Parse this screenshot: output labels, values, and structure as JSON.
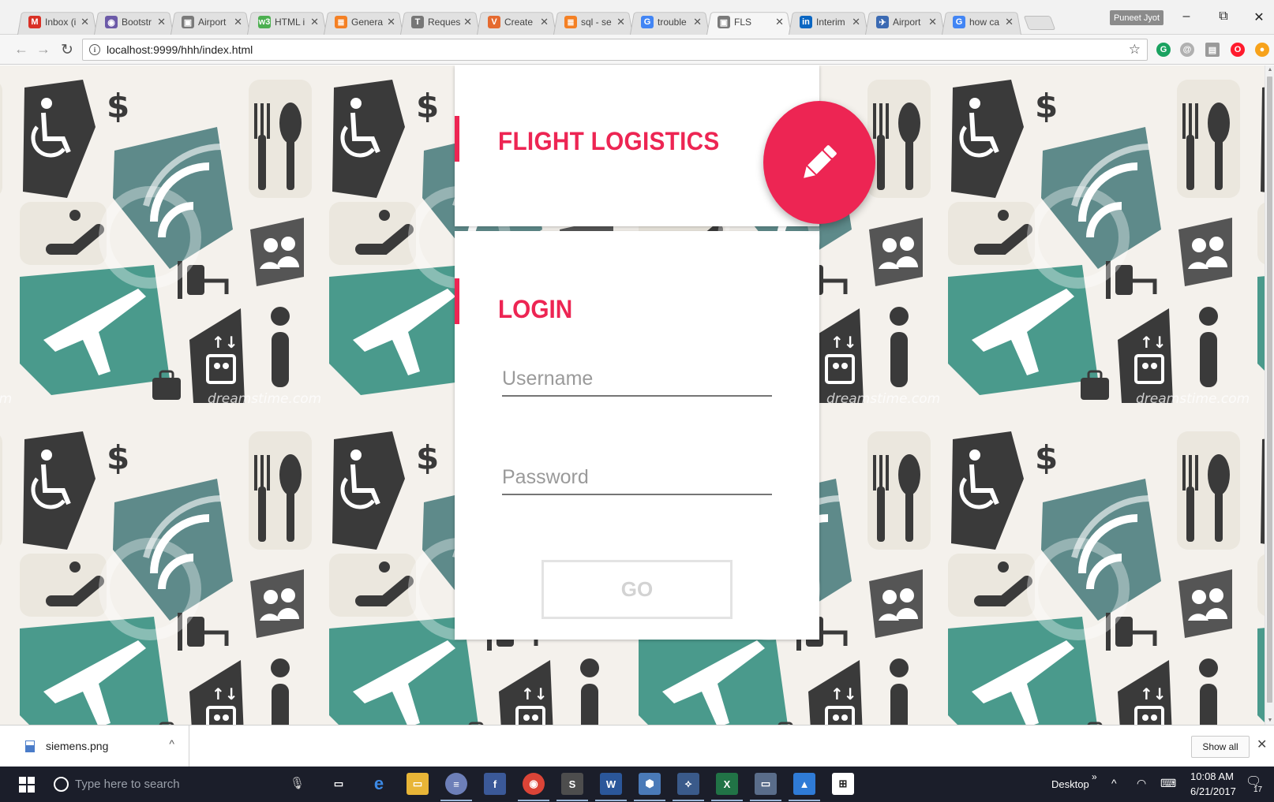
{
  "browser": {
    "tabs": [
      {
        "title": "Inbox (i",
        "favicon": "gmail-icon",
        "favicon_text": "M",
        "favicon_color": "#d93025",
        "active": false
      },
      {
        "title": "Bootstr",
        "favicon": "bootstrap-icon",
        "favicon_text": "◉",
        "favicon_color": "#6c5aa8",
        "active": false
      },
      {
        "title": "Airport",
        "favicon": "image-icon",
        "favicon_text": "▣",
        "favicon_color": "#7a7a7a",
        "active": false
      },
      {
        "title": "HTML i",
        "favicon": "w3schools-icon",
        "favicon_text": "w3",
        "favicon_color": "#4caf50",
        "active": false
      },
      {
        "title": "Genera",
        "favicon": "stackoverflow-icon",
        "favicon_text": "≣",
        "favicon_color": "#f48024",
        "active": false
      },
      {
        "title": "Reques",
        "favicon": "text-icon",
        "favicon_text": "T",
        "favicon_color": "#777777",
        "active": false
      },
      {
        "title": "Create",
        "favicon": "mailchimp-icon",
        "favicon_text": "V",
        "favicon_color": "#e56a2f",
        "active": false
      },
      {
        "title": "sql - se",
        "favicon": "stackoverflow-icon",
        "favicon_text": "≣",
        "favicon_color": "#f48024",
        "active": false
      },
      {
        "title": "trouble",
        "favicon": "google-icon",
        "favicon_text": "G",
        "favicon_color": "#4285f4",
        "active": false
      },
      {
        "title": "FLS",
        "favicon": "image-icon",
        "favicon_text": "▣",
        "favicon_color": "#7a7a7a",
        "active": true
      },
      {
        "title": "Interim",
        "favicon": "linkedin-icon",
        "favicon_text": "in",
        "favicon_color": "#0a66c2",
        "active": false
      },
      {
        "title": "Airport",
        "favicon": "airplane-icon",
        "favicon_text": "✈",
        "favicon_color": "#3b6ab3",
        "active": false
      },
      {
        "title": "how ca",
        "favicon": "google-icon",
        "favicon_text": "G",
        "favicon_color": "#4285f4",
        "active": false
      }
    ],
    "profile_name": "Puneet Jyot",
    "url": "localhost:9999/hhh/index.html"
  },
  "page": {
    "brand_title": "FLIGHT LOGISTICS",
    "login_title": "LOGIN",
    "username_placeholder": "Username",
    "password_placeholder": "Password",
    "go_label": "GO",
    "watermark": "dreamstime.com",
    "accent_color": "#ed2553"
  },
  "downloads": {
    "file_name": "siemens.png",
    "show_all_label": "Show all"
  },
  "taskbar": {
    "search_placeholder": "Type here to search",
    "desktop_label": "Desktop",
    "time": "10:08 AM",
    "date": "6/21/2017",
    "notification_count": "17"
  }
}
